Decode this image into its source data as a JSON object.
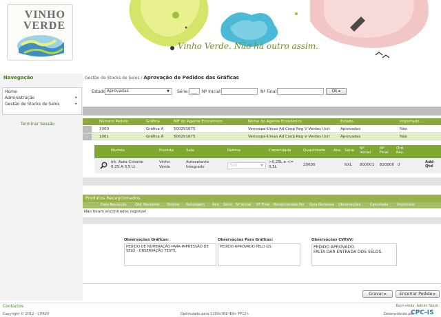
{
  "banner": {
    "logo_line1": "VINHO",
    "logo_line2": "VERDE",
    "slogan": "Vinho Verde. Não há outro assim."
  },
  "nav": {
    "title": "Navegação",
    "items": [
      {
        "label": "Home",
        "arrow": ""
      },
      {
        "label": "Administração",
        "arrow": "▸"
      },
      {
        "label": "Gestão de Stocks de Selos",
        "arrow": "▸"
      }
    ],
    "logout": "Terminar Sessão",
    "contacts": "Contactos"
  },
  "breadcrumb": {
    "parent": "Gestão de Stocks de Selos /",
    "current": "Aprovação de Pedidos das Gráficas"
  },
  "filters": {
    "estado_label": "Estado:",
    "estado_value": "Aprovadas",
    "serie_label": "Série:",
    "serie_value": "___",
    "inicial_label": "Nº Inicial:",
    "final_label": "Nº Final:",
    "ok_label": "Ok ▸"
  },
  "table": {
    "headers": [
      "Número Pedido",
      "Gráfica",
      "NIF do Agente Económico",
      "Nome do Agente Económico",
      "Estado",
      "Importado"
    ],
    "rows": [
      {
        "toggle": "›",
        "num": "1000",
        "grafica": "Gráfica A",
        "nif": "500291675",
        "nome": "Vercoope-Uniao Ad Coop Reg V Verdes Ucrl",
        "estado": "Aprovadas",
        "importado": "Não"
      },
      {
        "toggle": "⌄",
        "num": "1001",
        "grafica": "Gráfica A",
        "nif": "500291675",
        "nome": "Vercoope-Uniao Ad Coop Reg V Verdes Ucrl",
        "estado": "Aprovadas",
        "importado": "Não"
      }
    ]
  },
  "subtable": {
    "headers": [
      "Modelo",
      "Produto",
      "Selo",
      "Bobine",
      "Capacidade",
      "Quantidade",
      "Ano",
      "Série",
      "Nº Inicial",
      "Nº Final",
      "Qtd. Rec."
    ],
    "row": {
      "modelo_1": "Int. Auto-Colante",
      "modelo_2": "0,25 A 0,5 Lt",
      "produto_1": "Vinho",
      "produto_2": "Verde",
      "selo_1": "Autocolante",
      "selo_2": "Integrado",
      "bobine": "500",
      "capacidade_1": ">0,25L e <=",
      "capacidade_2": "0,5L",
      "quantidade": "20000",
      "ano": "",
      "serie": "NXL",
      "inicial": "800001",
      "final": "820000",
      "qtd_rec": "0",
      "add_1": "Add",
      "add_2": "Qtd"
    }
  },
  "produtos": {
    "title": "Produtos Recepcionados",
    "headers": [
      "Data Recepção",
      "Qtd. Recebida",
      "Bobine",
      "Rotulagem",
      "Ano",
      "Série",
      "Nº Inicial",
      "Nº Final",
      "Recepcionado Por",
      "Guia Remessa",
      "Observações",
      "Cancelada",
      "Importado"
    ],
    "empty": "Não foram encontrados registos!"
  },
  "obs": {
    "graficas_label": "Observações Gráficas:",
    "graficas_text": "PEDIDO DE NUMERAÇÃO PARA IMPRESSÃO DE SELO - OBSERVAÇÃO TESTE.",
    "para_label": "Observações Para Gráficas:",
    "para_text": "PEDIDO APROVADO PELO GS.",
    "cvrvv_label": "Observações CVRVV:",
    "cvrvv_line1": "PEDIDO APROVADO.",
    "cvrvv_line2": "FALTA DAR ENTRADA DOS SELOS."
  },
  "actions": {
    "save": "Gravar ▸",
    "close": "Encerrar Pedido ▸"
  },
  "footer": {
    "copyright": "Copyright © 2012 - CVRVV",
    "optimized": "Optimizado para 1200x768 IE9+ FF12+",
    "welcome": "Bem-vindo: Admin Stock",
    "developed": "Desenvolvido por",
    "dev_logo": "CPC-IS"
  },
  "colors": {
    "accent": "#8aaa3c",
    "brand_green": "#4a7b20"
  }
}
